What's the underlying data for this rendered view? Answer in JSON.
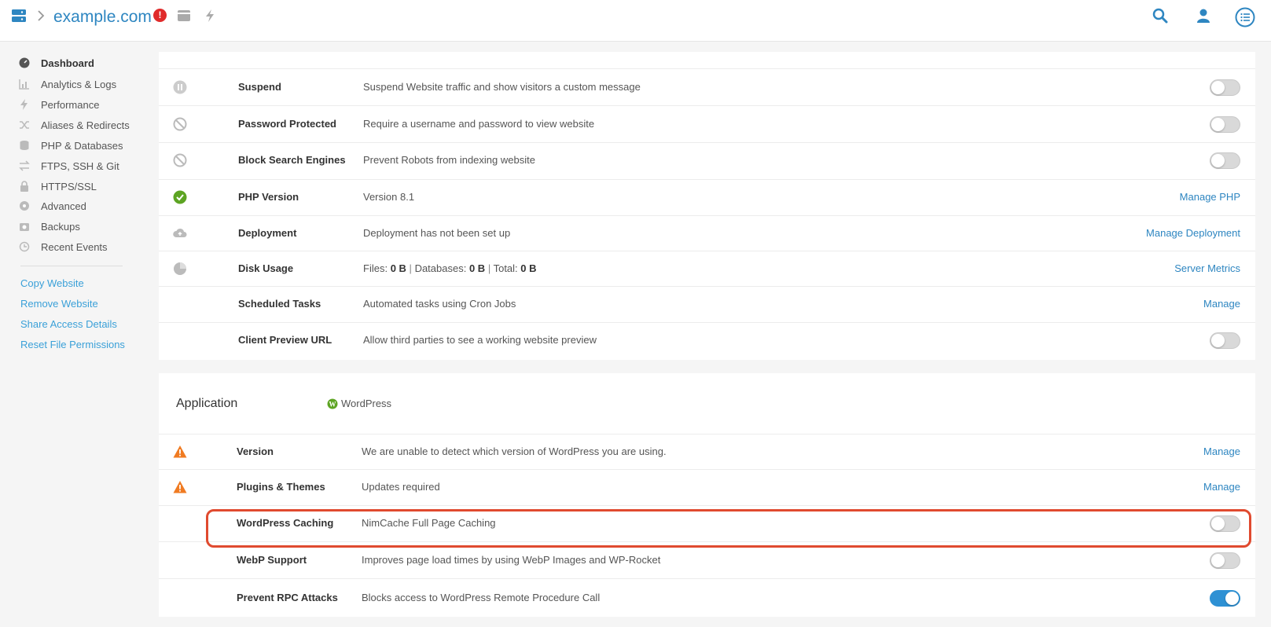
{
  "header": {
    "domain": "example.com",
    "alert_badge": "!"
  },
  "sidebar": {
    "items": [
      {
        "label": "Dashboard",
        "icon": "dashboard-icon",
        "active": true
      },
      {
        "label": "Analytics & Logs",
        "icon": "chart-icon"
      },
      {
        "label": "Performance",
        "icon": "bolt-icon"
      },
      {
        "label": "Aliases & Redirects",
        "icon": "shuffle-icon"
      },
      {
        "label": "PHP & Databases",
        "icon": "database-icon"
      },
      {
        "label": "FTPS, SSH & Git",
        "icon": "transfer-icon"
      },
      {
        "label": "HTTPS/SSL",
        "icon": "lock-icon"
      },
      {
        "label": "Advanced",
        "icon": "settings-icon"
      },
      {
        "label": "Backups",
        "icon": "camera-icon"
      },
      {
        "label": "Recent Events",
        "icon": "history-icon"
      }
    ],
    "links": [
      "Copy Website",
      "Remove Website",
      "Share Access Details",
      "Reset File Permissions"
    ]
  },
  "settings": {
    "suspend": {
      "title": "Suspend",
      "desc": "Suspend Website traffic and show visitors a custom message",
      "on": false
    },
    "password": {
      "title": "Password Protected",
      "desc": "Require a username and password to view website",
      "on": false
    },
    "block_search": {
      "title": "Block Search Engines",
      "desc": "Prevent Robots from indexing website",
      "on": false
    },
    "php": {
      "title": "PHP Version",
      "desc": "Version 8.1",
      "action": "Manage PHP"
    },
    "deployment": {
      "title": "Deployment",
      "desc": "Deployment has not been set up",
      "action": "Manage Deployment"
    },
    "disk": {
      "title": "Disk Usage",
      "files_label": "Files:",
      "files_value": "0 B",
      "db_label": "Databases:",
      "db_value": "0 B",
      "total_label": "Total:",
      "total_value": "0 B",
      "separator": "|",
      "action": "Server Metrics"
    },
    "scheduled": {
      "title": "Scheduled Tasks",
      "desc": "Automated tasks using Cron Jobs",
      "action": "Manage"
    },
    "preview": {
      "title": "Client Preview URL",
      "desc": "Allow third parties to see a working website preview",
      "on": false
    }
  },
  "application": {
    "title": "Application",
    "platform": "WordPress",
    "version": {
      "title": "Version",
      "desc": "We are unable to detect which version of WordPress you are using.",
      "action": "Manage"
    },
    "plugins": {
      "title": "Plugins & Themes",
      "desc": "Updates required",
      "action": "Manage"
    },
    "caching": {
      "title": "WordPress Caching",
      "desc": "NimCache Full Page Caching",
      "on": false
    },
    "webp": {
      "title": "WebP Support",
      "desc": "Improves page load times by using WebP Images and WP-Rocket",
      "on": false
    },
    "rpc": {
      "title": "Prevent RPC Attacks",
      "desc": "Blocks access to WordPress Remote Procedure Call",
      "on": true
    }
  },
  "colors": {
    "accent": "#2e86c1",
    "warning": "#f07b22",
    "success": "#5da423",
    "highlight": "#e04a2f"
  }
}
